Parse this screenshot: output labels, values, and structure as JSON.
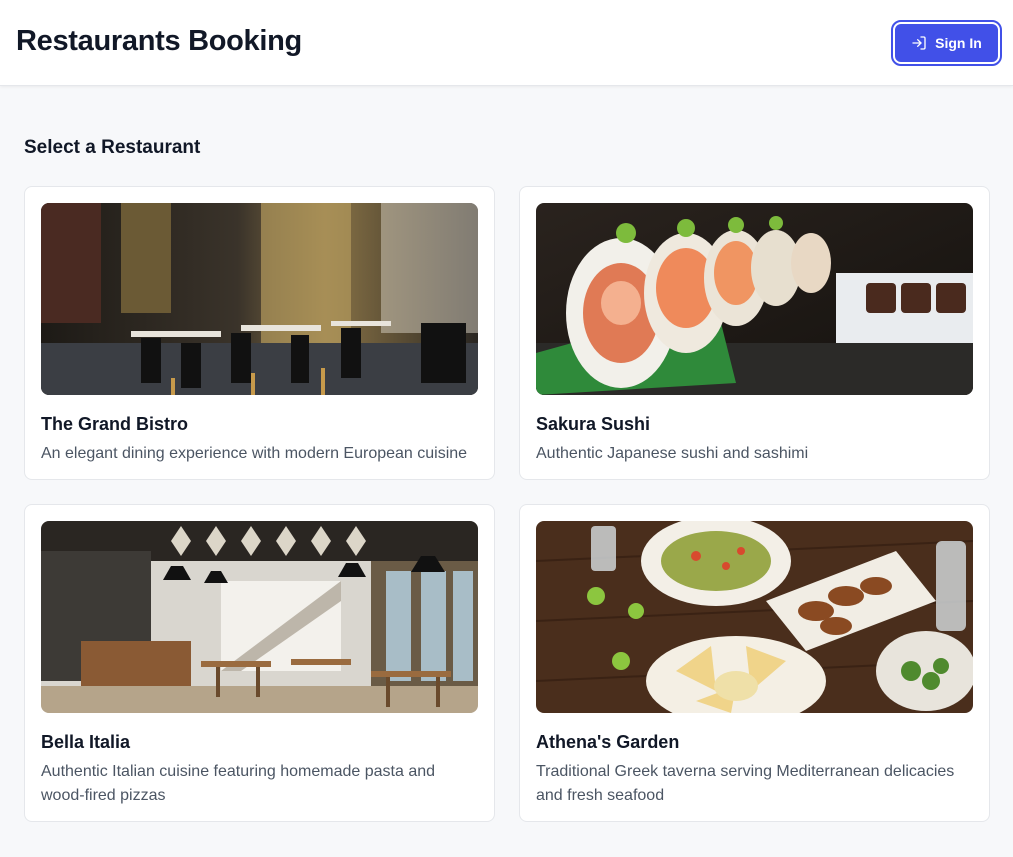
{
  "header": {
    "title": "Restaurants Booking",
    "sign_in_label": "Sign In",
    "sign_in_icon": "sign-in-icon"
  },
  "main": {
    "section_title": "Select a Restaurant"
  },
  "restaurants": [
    {
      "name": "The Grand Bistro",
      "description": "An elegant dining experience with modern European cuisine",
      "image": "restaurant-interior-photo"
    },
    {
      "name": "Sakura Sushi",
      "description": "Authentic Japanese sushi and sashimi",
      "image": "sushi-rolls-photo"
    },
    {
      "name": "Bella Italia",
      "description": "Authentic Italian cuisine featuring homemade pasta and wood-fired pizzas",
      "image": "cafe-interior-photo"
    },
    {
      "name": "Athena's Garden",
      "description": "Traditional Greek taverna serving Mediterranean delicacies and fresh seafood",
      "image": "mediterranean-food-table-photo"
    }
  ],
  "colors": {
    "accent": "#4150e8",
    "page_background": "#f7f8fa",
    "card_background": "#ffffff",
    "muted_text": "#4b5563"
  }
}
